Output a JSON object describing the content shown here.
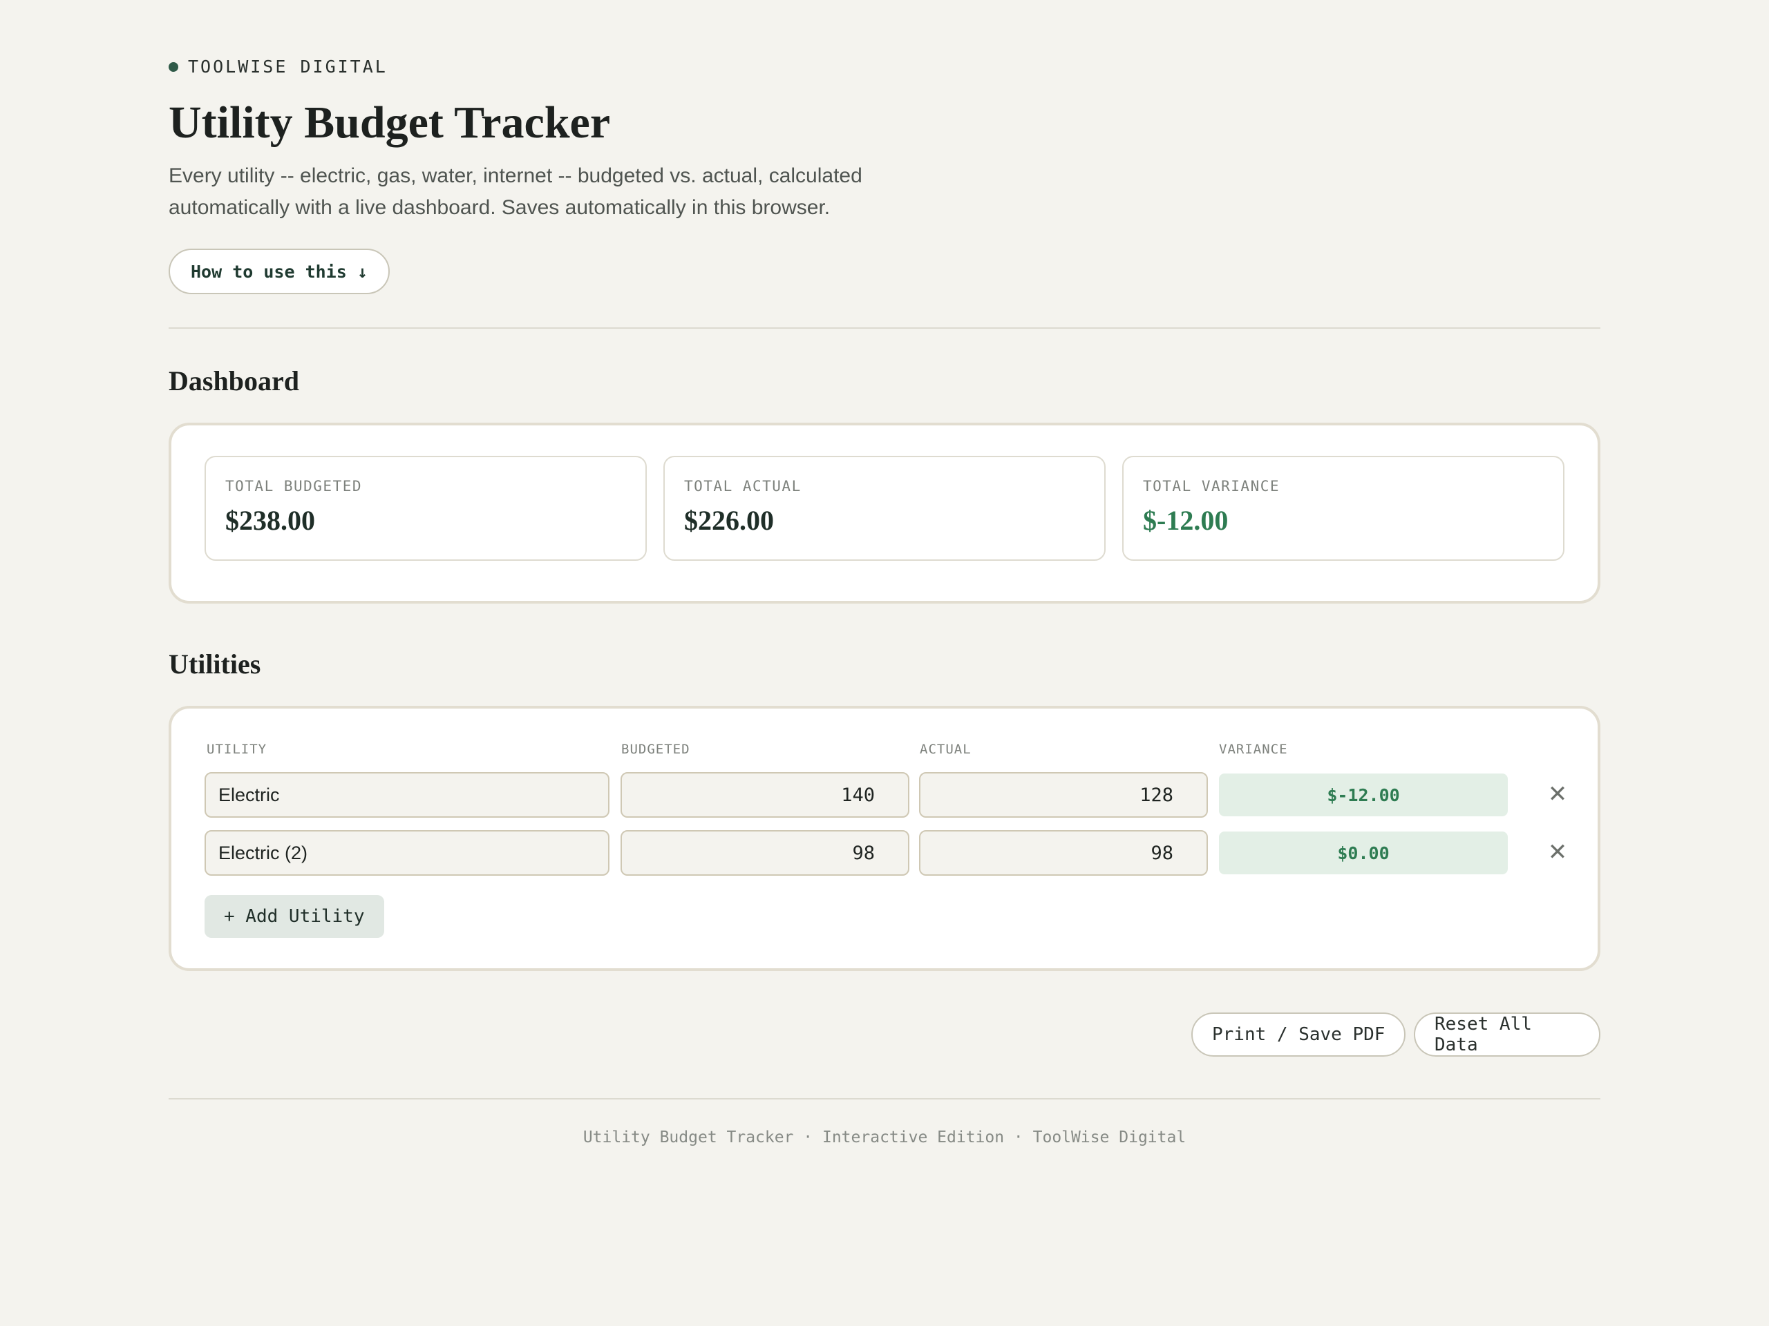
{
  "brand": {
    "name": "TOOLWISE DIGITAL"
  },
  "header": {
    "title": "Utility Budget Tracker",
    "subtitle": "Every utility -- electric, gas, water, internet -- budgeted vs. actual, calculated automatically with a live dashboard. Saves automatically in this browser.",
    "howto_label": "How to use this ↓"
  },
  "dashboard": {
    "title": "Dashboard",
    "stats": [
      {
        "label": "TOTAL BUDGETED",
        "value": "$238.00"
      },
      {
        "label": "TOTAL ACTUAL",
        "value": "$226.00"
      },
      {
        "label": "TOTAL VARIANCE",
        "value": "$-12.00"
      }
    ]
  },
  "utilities": {
    "title": "Utilities",
    "columns": [
      "UTILITY",
      "BUDGETED",
      "ACTUAL",
      "VARIANCE"
    ],
    "rows": [
      {
        "name": "Electric",
        "budgeted": "140",
        "actual": "128",
        "variance": "$-12.00"
      },
      {
        "name": "Electric (2)",
        "budgeted": "98",
        "actual": "98",
        "variance": "$0.00"
      }
    ],
    "remove_glyph": "✕",
    "add_label": "+ Add Utility"
  },
  "actions": {
    "print_label": "Print / Save PDF",
    "reset_label": "Reset All Data"
  },
  "footer": {
    "text": "Utility Budget Tracker · Interactive Edition · ToolWise Digital"
  },
  "colors": {
    "background": "#f4f3ee",
    "accent_green": "#2e7c52",
    "variance_bg": "#e3efe6",
    "card_border": "#e2ddd0"
  }
}
